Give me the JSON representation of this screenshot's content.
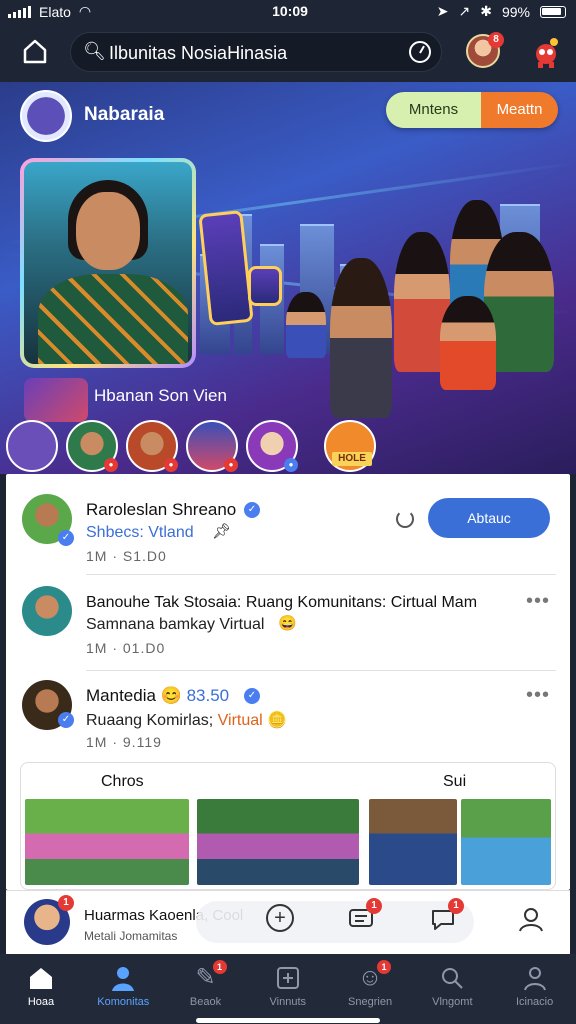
{
  "status_bar": {
    "carrier": "Elato",
    "time": "10:09",
    "battery": "99%"
  },
  "header": {
    "search_query": "Ilbunitas NosiaHinasia",
    "avatar_badge": "8"
  },
  "hero": {
    "community_name": "Nabaraia",
    "toggle_left": "Mntens",
    "toggle_right": "Meattn",
    "featured_label": "Hbanan Son Vien",
    "live_badge": "HOLE",
    "stories": [
      {
        "color": "#6a4fb8"
      },
      {
        "color": "#2f7a4a"
      },
      {
        "color": "#b84a2a"
      },
      {
        "color": "#3a4fb8"
      },
      {
        "color": "#8a3ab8"
      }
    ]
  },
  "feed": {
    "posts": [
      {
        "name": "Raroleslan Shreano",
        "sub": "Shbecs: Vtland",
        "meta": "1M  ·  S1.D0",
        "button": "Abtauc"
      },
      {
        "name": "Banouhe Tak Stosaia: Ruang Komunitans: Cirtual Mam",
        "sub": "Samnana bamkay Virtual",
        "meta": "1M  ·  01.D0"
      },
      {
        "name": "Mantedia",
        "stat": "83.50",
        "sub_prefix": "Ruaang Komirlas;",
        "sub_highlight": "Virtual",
        "meta": "1M  ·  9.119"
      }
    ],
    "media": {
      "left_label": "Chros",
      "right_label": "Sui"
    }
  },
  "composer": {
    "title": "Huarmas Kaoenla, Cool",
    "subtitle": "Metali Jomamitas",
    "badge_a": "1",
    "badge_b": "1",
    "avatar_badge": "1"
  },
  "bottom_nav": {
    "items": [
      {
        "label": "Hoaa"
      },
      {
        "label": "Komonitas"
      },
      {
        "label": "Beaok"
      },
      {
        "label": "Vinnuts"
      },
      {
        "label": "Snegrien"
      },
      {
        "label": "Vlngomt"
      },
      {
        "label": "Icinacio"
      }
    ],
    "badge_a": "1",
    "badge_b": "1"
  }
}
